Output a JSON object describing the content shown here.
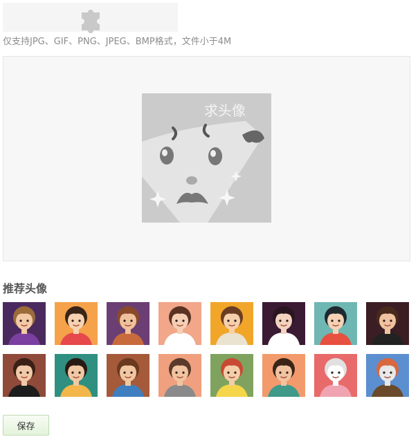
{
  "upload": {
    "icon": "puzzle-icon",
    "hint": "仅支持JPG、GIF、PNG、JPEG、BMP格式，文件小于4M"
  },
  "preview": {
    "placeholder_text": "求头像"
  },
  "recommended": {
    "title": "推荐头像",
    "avatars": [
      {
        "name": "avatar-1",
        "bg": "#4a2a5e",
        "skin": "#f3c9a6",
        "hair": "#9b6b3a",
        "shirt": "#7a3fa0"
      },
      {
        "name": "avatar-2",
        "bg": "#f5a24b",
        "skin": "#f6d2b0",
        "hair": "#3a2418",
        "shirt": "#e6484b"
      },
      {
        "name": "avatar-3",
        "bg": "#6b3f73",
        "skin": "#efc19d",
        "hair": "#8a4a2a",
        "shirt": "#c76a3c"
      },
      {
        "name": "avatar-4",
        "bg": "#f2a68a",
        "skin": "#f5cfb4",
        "hair": "#5a3322",
        "shirt": "#ffffff"
      },
      {
        "name": "avatar-5",
        "bg": "#f1a62a",
        "skin": "#f6d0ad",
        "hair": "#6b3d22",
        "shirt": "#e9e3d0"
      },
      {
        "name": "avatar-6",
        "bg": "#3b1a34",
        "skin": "#f3d3c0",
        "hair": "#2a1620",
        "shirt": "#ffffff"
      },
      {
        "name": "avatar-7",
        "bg": "#6fb7b3",
        "skin": "#f5d2b6",
        "hair": "#1e2a30",
        "shirt": "#e8503f"
      },
      {
        "name": "avatar-8",
        "bg": "#3a1e24",
        "skin": "#efc3a0",
        "hair": "#4a2a1c",
        "shirt": "#222222"
      },
      {
        "name": "avatar-9",
        "bg": "#8f4a3a",
        "skin": "#f1c9a8",
        "hair": "#3a2016",
        "shirt": "#1d1d1d"
      },
      {
        "name": "avatar-10",
        "bg": "#2f8f80",
        "skin": "#f0c8a4",
        "hair": "#2a1a14",
        "shirt": "#f3b64a"
      },
      {
        "name": "avatar-11",
        "bg": "#a55a3a",
        "skin": "#f1c7a2",
        "hair": "#6a3a1e",
        "shirt": "#3f7fbf"
      },
      {
        "name": "avatar-12",
        "bg": "#f0a07e",
        "skin": "#f0c4a0",
        "hair": "#5a3a2a",
        "shirt": "#8a8a8a"
      },
      {
        "name": "avatar-13",
        "bg": "#7fa35e",
        "skin": "#f4cda9",
        "hair": "#c94a34",
        "shirt": "#f5d54a"
      },
      {
        "name": "avatar-14",
        "bg": "#f39a6c",
        "skin": "#f2c3a0",
        "hair": "#3a2418",
        "shirt": "#3f9a8a"
      },
      {
        "name": "avatar-15",
        "bg": "#e86a6a",
        "skin": "#ffffff",
        "hair": "#e0e0e0",
        "shirt": "#f0a3b0"
      },
      {
        "name": "avatar-16",
        "bg": "#5c8fd0",
        "skin": "#e8e8e8",
        "hair": "#d9673f",
        "shirt": "#6a4a2a"
      }
    ]
  },
  "actions": {
    "save_label": "保存"
  }
}
